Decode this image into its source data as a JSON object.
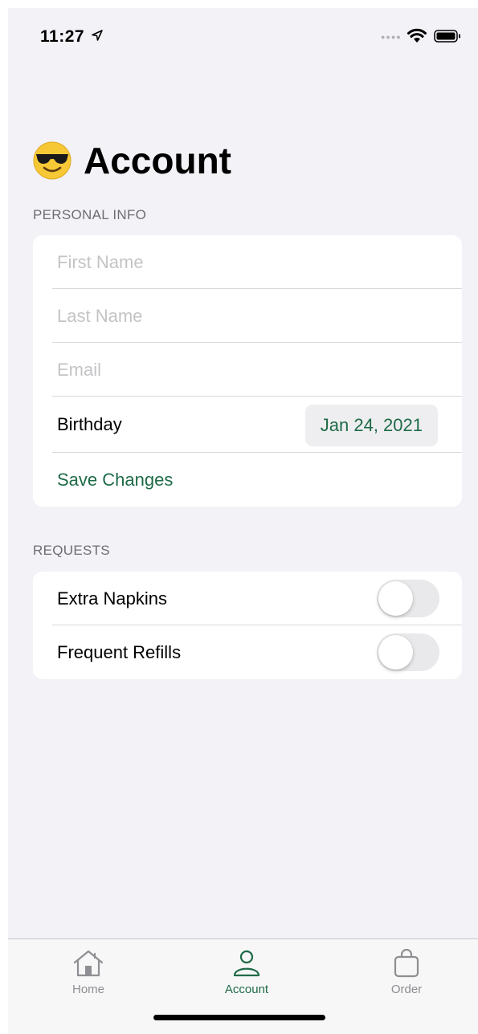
{
  "status_bar": {
    "time": "11:27",
    "icons": [
      "location-arrow-icon",
      "signal-dots-icon",
      "wifi-icon",
      "battery-icon"
    ]
  },
  "header": {
    "emoji": "😎",
    "title": "Account"
  },
  "personal_info": {
    "section_title": "PERSONAL INFO",
    "first_name": {
      "placeholder": "First Name",
      "value": ""
    },
    "last_name": {
      "placeholder": "Last Name",
      "value": ""
    },
    "email": {
      "placeholder": "Email",
      "value": ""
    },
    "birthday": {
      "label": "Birthday",
      "value": "Jan 24, 2021"
    },
    "save_label": "Save Changes"
  },
  "requests": {
    "section_title": "REQUESTS",
    "items": [
      {
        "label": "Extra Napkins",
        "on": false
      },
      {
        "label": "Frequent Refills",
        "on": false
      }
    ]
  },
  "tabbar": {
    "tabs": [
      {
        "label": "Home",
        "icon": "house-icon",
        "active": false
      },
      {
        "label": "Account",
        "icon": "person-icon",
        "active": true
      },
      {
        "label": "Order",
        "icon": "bag-icon",
        "active": false
      }
    ]
  },
  "colors": {
    "accent": "#1e6b47",
    "background": "#f2f2f7",
    "card": "#ffffff",
    "placeholder": "#c4c4c7",
    "section_header": "#6d6d72",
    "toggle_off": "#e9e9eb"
  }
}
